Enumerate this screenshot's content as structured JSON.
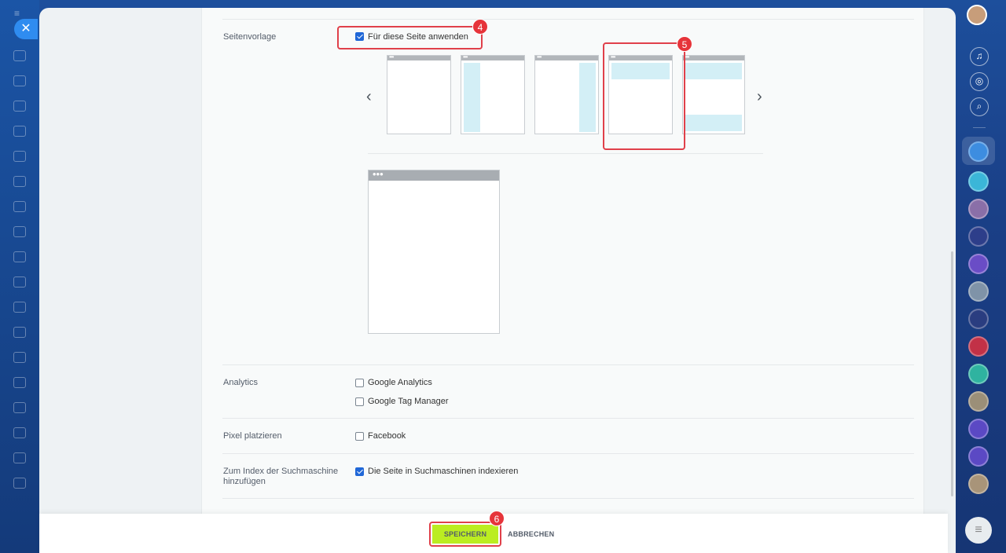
{
  "form": {
    "page_template": {
      "label": "Seitenvorlage",
      "apply_option": "Für diese Seite anwenden",
      "apply_checked": true,
      "templates": [
        "empty",
        "left-sidebar",
        "right-sidebar",
        "header",
        "header-footer"
      ],
      "selected_template": "header"
    },
    "analytics": {
      "label": "Analytics",
      "options": [
        {
          "label": "Google Analytics",
          "checked": false
        },
        {
          "label": "Google Tag Manager",
          "checked": false
        }
      ]
    },
    "pixel": {
      "label": "Pixel platzieren",
      "options": [
        {
          "label": "Facebook",
          "checked": false
        }
      ]
    },
    "search_index": {
      "label_line1": "Zum Index der Suchmaschine",
      "label_line2": "hinzufügen",
      "option": "Die Seite in Suchmaschinen indexieren",
      "checked": true
    }
  },
  "footer": {
    "save_label": "SPEICHERN",
    "cancel_label": "ABBRECHEN"
  },
  "annotations": {
    "step_apply": "4",
    "step_template": "5",
    "step_save": "6"
  },
  "colors": {
    "accent_save": "#bbed21",
    "annotation_red": "#e0404a",
    "checkbox_blue": "#2067d7",
    "template_block": "#d3eff6"
  },
  "icons": {
    "close": "close-icon",
    "prev": "chevron-left-icon",
    "next": "chevron-right-icon",
    "chat_bubble": "chat-icon"
  }
}
